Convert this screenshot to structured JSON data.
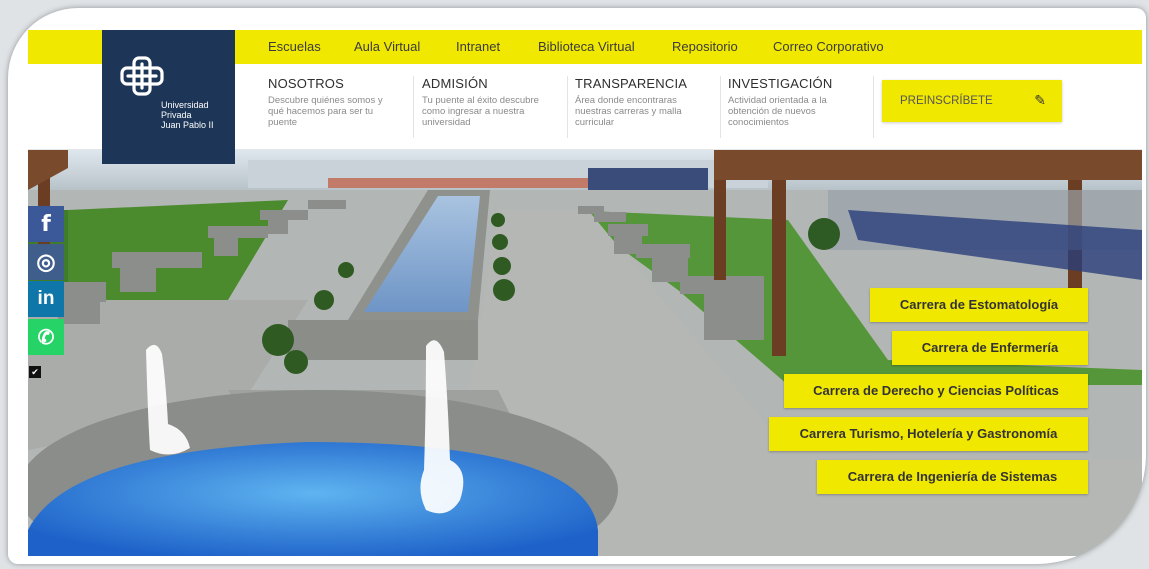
{
  "topbar": {
    "links": [
      "Escuelas",
      "Aula Virtual",
      "Intranet",
      "Biblioteca Virtual",
      "Repositorio",
      "Correo Corporativo"
    ]
  },
  "logo": {
    "line1": "Universidad",
    "line2": "Privada",
    "line3": "Juan Pablo II"
  },
  "nav": [
    {
      "title": "NOSOTROS",
      "desc": "Descubre quiénes somos y qué hacemos para ser tu puente"
    },
    {
      "title": "ADMISIÓN",
      "desc": "Tu puente al éxito descubre como ingresar a nuestra universidad"
    },
    {
      "title": "TRANSPARENCIA",
      "desc": "Área donde encontraras nuestras carreras y malla curricular"
    },
    {
      "title": "INVESTIGACIÓN",
      "desc": "Actividad orientada a la obtención de nuevos conocimientos"
    }
  ],
  "preinscribete": {
    "label": "PREINSCRÍBETE",
    "icon": "pencil-icon"
  },
  "social": [
    {
      "name": "facebook",
      "glyph": "f",
      "color": "#3b5998"
    },
    {
      "name": "instagram",
      "glyph": "◎",
      "color": "#3f5e8c"
    },
    {
      "name": "linkedin",
      "glyph": "in",
      "color": "#0e76a8"
    },
    {
      "name": "whatsapp",
      "glyph": "✆",
      "color": "#25d366"
    }
  ],
  "careers": [
    "Carrera de Estomatología",
    "Carrera de Enfermería",
    "Carrera de Derecho y Ciencias Políticas",
    "Carrera Turismo, Hotelería y Gastronomía",
    "Carrera de Ingeniería de Sistemas"
  ],
  "colors": {
    "brand_yellow": "#f1e800",
    "brand_navy": "#1d3557"
  }
}
